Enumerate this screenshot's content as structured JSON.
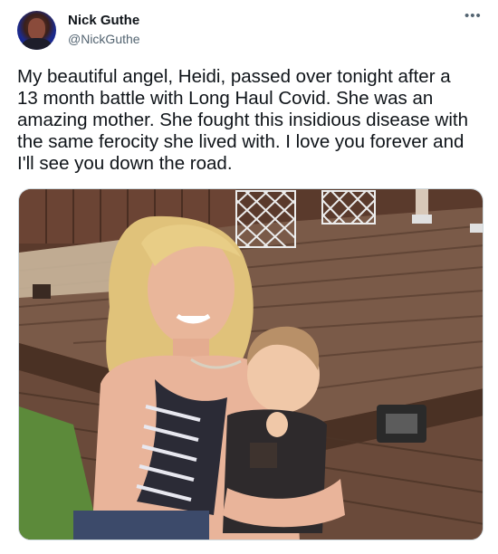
{
  "tweet": {
    "display_name": "Nick Guthe",
    "handle": "@NickGuthe",
    "more_icon": "more-icon",
    "text": "My beautiful angel, Heidi, passed over tonight after a\n13 month battle with Long Haul Covid. She was an\namazing mother. She fought this insidious disease with\nthe same ferocity she lived with. I love you forever and\nI'll see you down the road.",
    "media": {
      "type": "photo"
    }
  },
  "colors": {
    "text_primary": "#0f1419",
    "text_secondary": "#536471",
    "border": "#cfd9de"
  }
}
